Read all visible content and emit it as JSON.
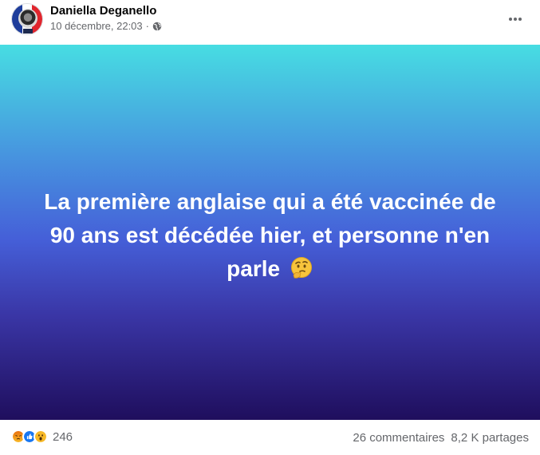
{
  "post": {
    "author": "Daniella Deganello",
    "timestamp": "10 décembre, 22:03",
    "separator": "·",
    "privacy_icon": "globe-icon",
    "more_icon": "more-options-icon",
    "text_line1": "La première anglaise qui a été vaccinée de",
    "text_line2": "90 ans est décédée hier, et personne n'en",
    "text_line3": "parle",
    "text_emoji": "thinking-face-emoji",
    "background_gradient": [
      "#47dde2",
      "#4793df",
      "#455fd8",
      "#3a36a6",
      "#1f0e5d"
    ]
  },
  "avatar": {
    "colors": [
      "#1e3d9b",
      "#ffffff",
      "#e0252d"
    ]
  },
  "footer": {
    "reactions": [
      "angry",
      "like",
      "wow"
    ],
    "reaction_count": "246",
    "comments": "26 commentaires",
    "shares": "8,2 K partages"
  },
  "colors": {
    "secondary_text": "#65676b",
    "like_blue": "#1877f2",
    "reaction_yellow": "#f7b928",
    "angry_orange": "#e9710f"
  }
}
